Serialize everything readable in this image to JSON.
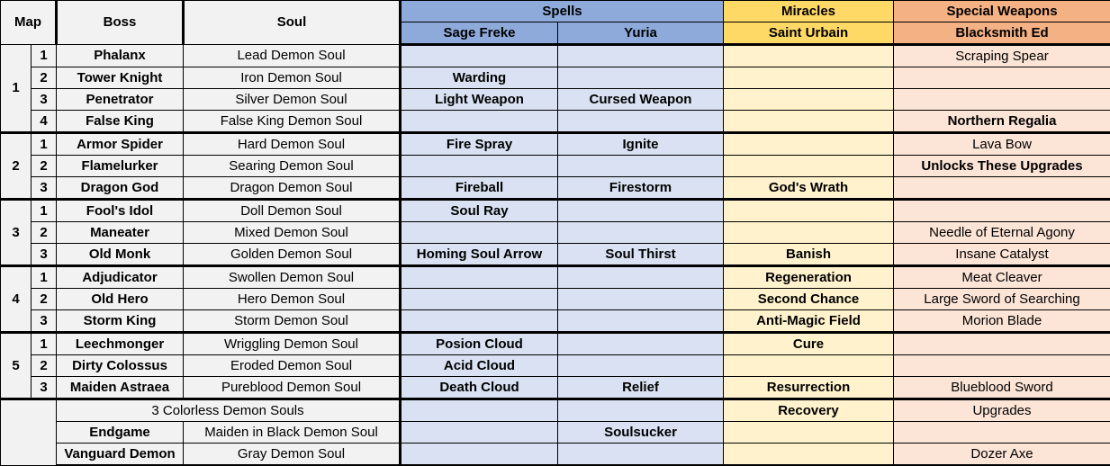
{
  "headers": {
    "map": "Map",
    "boss": "Boss",
    "soul": "Soul",
    "spells": "Spells",
    "miracles": "Miracles",
    "special_weapons": "Special Weapons",
    "sage_freke": "Sage Freke",
    "yuria": "Yuria",
    "saint_urbain": "Saint Urbain",
    "blacksmith_ed": "Blacksmith Ed"
  },
  "colors": {
    "spells_header": "#8eaadb",
    "spells_cell": "#d9e1f2",
    "miracles_header": "#ffd966",
    "miracles_cell": "#fff2cc",
    "weapons_header": "#f4b183",
    "weapons_cell": "#fce4d6",
    "base_cell": "#f2f2f2"
  },
  "maps": [
    "1",
    "2",
    "3",
    "4",
    "5"
  ],
  "rows": [
    {
      "sub": "1",
      "boss": "Phalanx",
      "soul": "Lead Demon Soul",
      "freke": "",
      "yuria": "",
      "urbain": "",
      "ed": "Scraping Spear",
      "ed_bold": false
    },
    {
      "sub": "2",
      "boss": "Tower Knight",
      "soul": "Iron Demon Soul",
      "freke": "Warding",
      "yuria": "",
      "urbain": "",
      "ed": "",
      "ed_bold": false
    },
    {
      "sub": "3",
      "boss": "Penetrator",
      "soul": "Silver Demon Soul",
      "freke": "Light Weapon",
      "yuria": "Cursed Weapon",
      "urbain": "",
      "ed": "",
      "ed_bold": false
    },
    {
      "sub": "4",
      "boss": "False King",
      "soul": "False King Demon Soul",
      "freke": "",
      "yuria": "",
      "urbain": "",
      "ed": "Northern Regalia",
      "ed_bold": true
    },
    {
      "sub": "1",
      "boss": "Armor Spider",
      "soul": "Hard Demon Soul",
      "freke": "Fire Spray",
      "yuria": "Ignite",
      "urbain": "",
      "ed": "Lava Bow",
      "ed_bold": false
    },
    {
      "sub": "2",
      "boss": "Flamelurker",
      "soul": "Searing Demon Soul",
      "freke": "",
      "yuria": "",
      "urbain": "",
      "ed": "Unlocks These Upgrades",
      "ed_bold": true
    },
    {
      "sub": "3",
      "boss": "Dragon God",
      "soul": "Dragon Demon Soul",
      "freke": "Fireball",
      "yuria": "Firestorm",
      "urbain": "God's Wrath",
      "ed": "",
      "ed_bold": false
    },
    {
      "sub": "1",
      "boss": "Fool's Idol",
      "soul": "Doll Demon Soul",
      "freke": "Soul Ray",
      "yuria": "",
      "urbain": "",
      "ed": "",
      "ed_bold": false
    },
    {
      "sub": "2",
      "boss": "Maneater",
      "soul": "Mixed Demon Soul",
      "freke": "",
      "yuria": "",
      "urbain": "",
      "ed": "Needle of Eternal Agony",
      "ed_bold": false
    },
    {
      "sub": "3",
      "boss": "Old Monk",
      "soul": "Golden Demon Soul",
      "freke": "Homing Soul Arrow",
      "yuria": "Soul Thirst",
      "urbain": "Banish",
      "ed": "Insane Catalyst",
      "ed_bold": false
    },
    {
      "sub": "1",
      "boss": "Adjudicator",
      "soul": "Swollen Demon Soul",
      "freke": "",
      "yuria": "",
      "urbain": "Regeneration",
      "ed": "Meat Cleaver",
      "ed_bold": false
    },
    {
      "sub": "2",
      "boss": "Old Hero",
      "soul": "Hero Demon Soul",
      "freke": "",
      "yuria": "",
      "urbain": "Second Chance",
      "ed": "Large Sword of Searching",
      "ed_bold": false
    },
    {
      "sub": "3",
      "boss": "Storm King",
      "soul": "Storm Demon Soul",
      "freke": "",
      "yuria": "",
      "urbain": "Anti-Magic Field",
      "ed": "Morion Blade",
      "ed_bold": false
    },
    {
      "sub": "1",
      "boss": "Leechmonger",
      "soul": "Wriggling Demon Soul",
      "freke": "Posion Cloud",
      "yuria": "",
      "urbain": "Cure",
      "ed": "",
      "ed_bold": false
    },
    {
      "sub": "2",
      "boss": "Dirty Colossus",
      "soul": "Eroded Demon Soul",
      "freke": "Acid Cloud",
      "yuria": "",
      "urbain": "",
      "ed": "",
      "ed_bold": false
    },
    {
      "sub": "3",
      "boss": "Maiden Astraea",
      "soul": "Pureblood Demon Soul",
      "freke": "Death Cloud",
      "yuria": "Relief",
      "urbain": "Resurrection",
      "ed": "Blueblood Sword",
      "ed_bold": false
    }
  ],
  "extra": {
    "colorless": {
      "label": "3 Colorless Demon Souls",
      "freke": "",
      "yuria": "",
      "urbain": "Recovery",
      "ed": "Upgrades"
    },
    "endgame": {
      "boss": "Endgame",
      "soul": "Maiden in Black Demon Soul",
      "freke": "",
      "yuria": "Soulsucker",
      "urbain": "",
      "ed": ""
    },
    "vanguard": {
      "boss": "Vanguard Demon",
      "soul": "Gray Demon Soul",
      "freke": "",
      "yuria": "",
      "urbain": "",
      "ed": "Dozer Axe"
    }
  }
}
